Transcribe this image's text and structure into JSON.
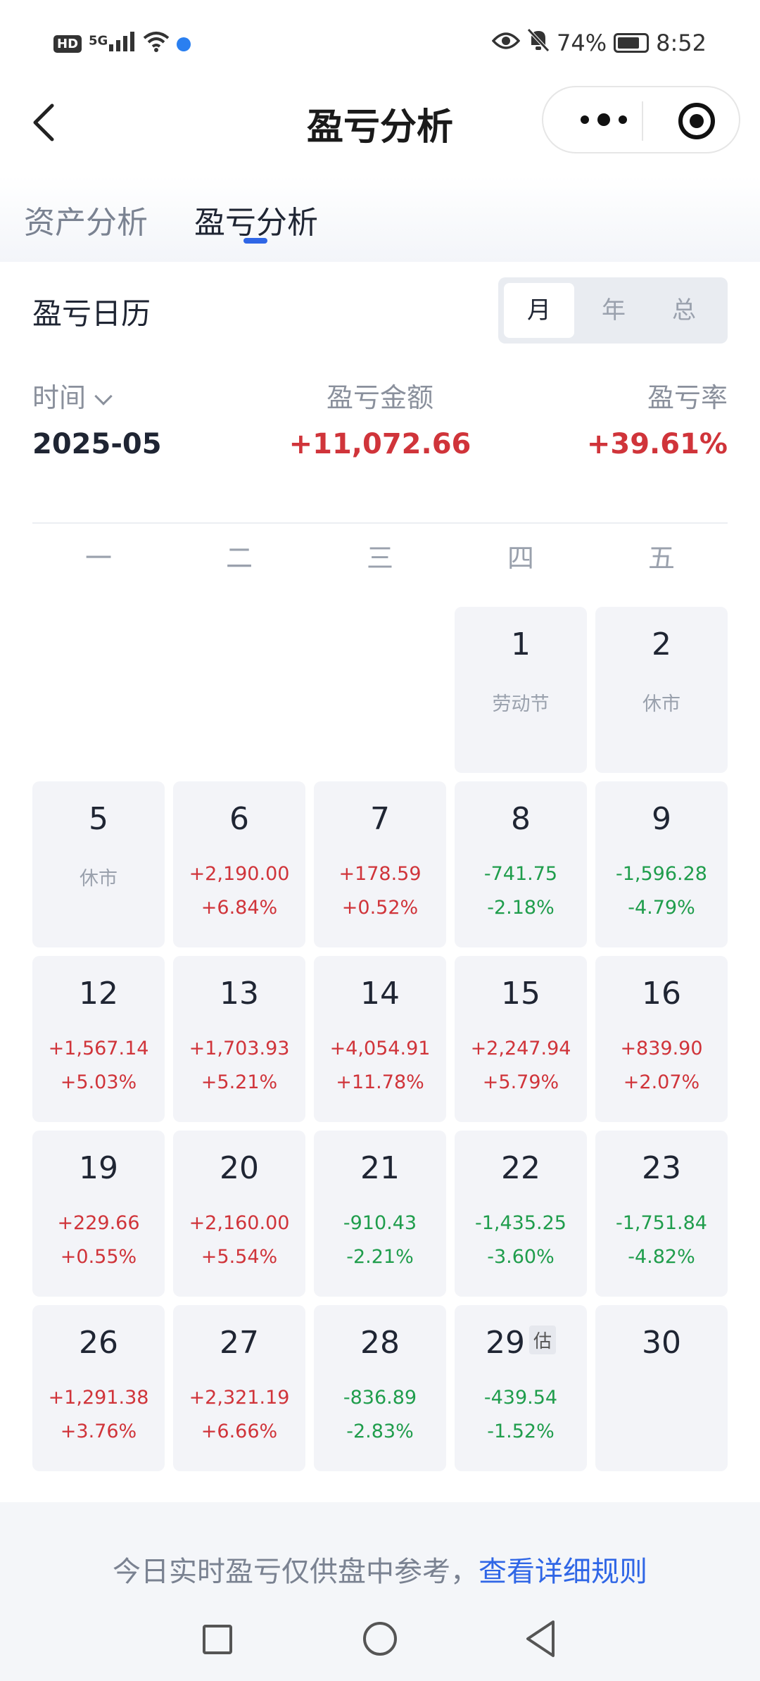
{
  "status_bar": {
    "hd_badge": "HD",
    "signal_label": "5G",
    "battery_pct": "74%",
    "time": "8:52",
    "icons": [
      "hd-icon",
      "signal-icon",
      "wifi-icon",
      "app-dot-icon",
      "eye-icon",
      "bell-off-icon",
      "battery-icon"
    ]
  },
  "header": {
    "title": "盈亏分析"
  },
  "tabs": [
    {
      "label": "资产分析",
      "active": false
    },
    {
      "label": "盈亏分析",
      "active": true
    }
  ],
  "calendar": {
    "title": "盈亏日历",
    "segments": [
      {
        "label": "月",
        "active": true
      },
      {
        "label": "年",
        "active": false
      },
      {
        "label": "总",
        "active": false
      }
    ],
    "summary": {
      "time_label": "时间",
      "amount_label": "盈亏金额",
      "rate_label": "盈亏率",
      "date": "2025-05",
      "amount": "+11,072.66",
      "rate": "+39.61%"
    },
    "weekdays": [
      "一",
      "二",
      "三",
      "四",
      "五"
    ],
    "weeks": [
      [
        null,
        null,
        null,
        {
          "day": "1",
          "note": "劳动节"
        },
        {
          "day": "2",
          "note": "休市"
        }
      ],
      [
        {
          "day": "5",
          "note": "休市"
        },
        {
          "day": "6",
          "amount": "+2,190.00",
          "rate": "+6.84%",
          "dir": "up"
        },
        {
          "day": "7",
          "amount": "+178.59",
          "rate": "+0.52%",
          "dir": "up"
        },
        {
          "day": "8",
          "amount": "-741.75",
          "rate": "-2.18%",
          "dir": "down"
        },
        {
          "day": "9",
          "amount": "-1,596.28",
          "rate": "-4.79%",
          "dir": "down"
        }
      ],
      [
        {
          "day": "12",
          "amount": "+1,567.14",
          "rate": "+5.03%",
          "dir": "up"
        },
        {
          "day": "13",
          "amount": "+1,703.93",
          "rate": "+5.21%",
          "dir": "up"
        },
        {
          "day": "14",
          "amount": "+4,054.91",
          "rate": "+11.78%",
          "dir": "up"
        },
        {
          "day": "15",
          "amount": "+2,247.94",
          "rate": "+5.79%",
          "dir": "up"
        },
        {
          "day": "16",
          "amount": "+839.90",
          "rate": "+2.07%",
          "dir": "up"
        }
      ],
      [
        {
          "day": "19",
          "amount": "+229.66",
          "rate": "+0.55%",
          "dir": "up"
        },
        {
          "day": "20",
          "amount": "+2,160.00",
          "rate": "+5.54%",
          "dir": "up"
        },
        {
          "day": "21",
          "amount": "-910.43",
          "rate": "-2.21%",
          "dir": "down"
        },
        {
          "day": "22",
          "amount": "-1,435.25",
          "rate": "-3.60%",
          "dir": "down"
        },
        {
          "day": "23",
          "amount": "-1,751.84",
          "rate": "-4.82%",
          "dir": "down"
        }
      ],
      [
        {
          "day": "26",
          "amount": "+1,291.38",
          "rate": "+3.76%",
          "dir": "up"
        },
        {
          "day": "27",
          "amount": "+2,321.19",
          "rate": "+6.66%",
          "dir": "up"
        },
        {
          "day": "28",
          "amount": "-836.89",
          "rate": "-2.83%",
          "dir": "down"
        },
        {
          "day": "29",
          "badge": "估",
          "amount": "-439.54",
          "rate": "-1.52%",
          "dir": "down"
        },
        {
          "day": "30"
        }
      ]
    ]
  },
  "footer": {
    "note": "今日实时盈亏仅供盘中参考，",
    "link": "查看详细规则"
  },
  "colors": {
    "up": "#d0343a",
    "down": "#1f9d4c",
    "accent": "#2f66e6"
  }
}
